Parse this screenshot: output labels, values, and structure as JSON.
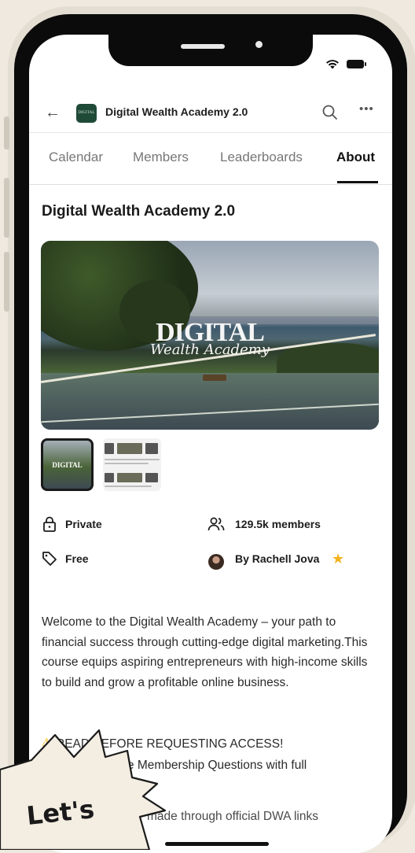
{
  "header": {
    "back_icon": "arrow-left-icon",
    "logo_text": "DIGITAL",
    "title": "Digital Wealth Academy 2.0",
    "search_icon": "search-icon",
    "more_icon": "more-horizontal-icon"
  },
  "tabs": [
    {
      "label": "Calendar",
      "active": false
    },
    {
      "label": "Members",
      "active": false
    },
    {
      "label": "Leaderboards",
      "active": false
    },
    {
      "label": "About",
      "active": true
    }
  ],
  "about": {
    "title": "Digital Wealth Academy 2.0",
    "hero": {
      "line1": "DIGITAL",
      "line2": "Wealth Academy"
    },
    "thumb_label": "DIGITAL",
    "meta": {
      "privacy": "Private",
      "members": "129.5k members",
      "price": "Free",
      "owner": "By Rachell Jova"
    },
    "description": "Welcome to the Digital Wealth Academy – your path to financial success through cutting-edge digital marketing.This course equips aspiring entrepreneurs with high-income skills to build and grow a profitable online business.",
    "notice_line1": "READ BEFORE REQUESTING ACCESS!",
    "notice_line2": "the Membership Questions with full",
    "notice_line3": "made through official DWA links"
  },
  "overlay": {
    "text": "Let's"
  },
  "colors": {
    "accent": "#111111",
    "star": "#f2b21b",
    "logo_bg": "#1f4a38",
    "background": "#efe9e0"
  }
}
